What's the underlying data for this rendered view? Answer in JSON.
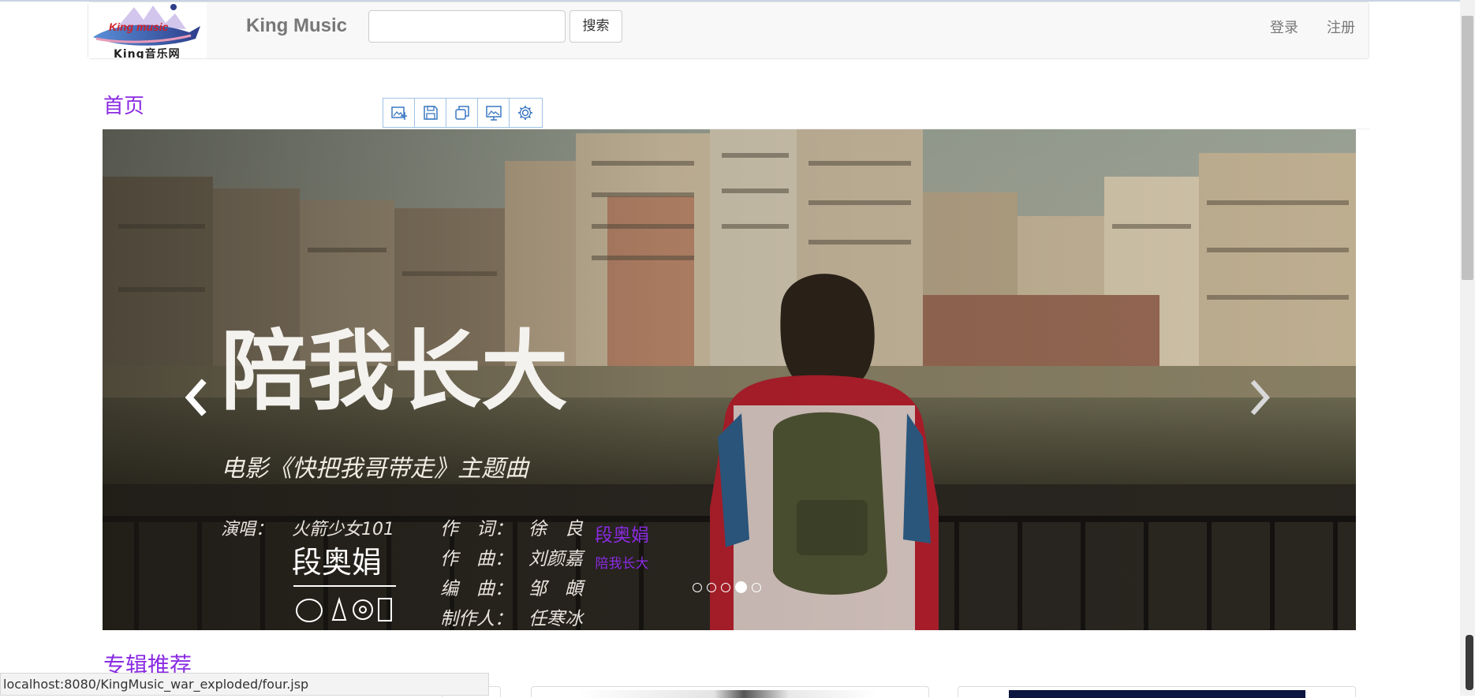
{
  "navbar": {
    "logo_text_top": "King music",
    "logo_text_bottom": "King音乐网",
    "brand": "King Music",
    "search_placeholder": "",
    "search_button": "搜索",
    "login": "登录",
    "register": "注册"
  },
  "page": {
    "title": "首页",
    "section_album": "专辑推荐"
  },
  "image_toolbar": {
    "icons": [
      "image-search-icon",
      "save-icon",
      "copy-icon",
      "screen-image-icon",
      "gear-icon"
    ]
  },
  "carousel": {
    "poster": {
      "title": "陪我长大",
      "subtitle": "电影《快把我哥带走》主题曲",
      "credits_left_label": "演唱：",
      "credits_left_value": "火箭少女101",
      "credits_singer": "段奥娟",
      "credit_lyrics_label": "作　词：",
      "credit_lyrics_value": "徐　良",
      "credit_music_label": "作　曲：",
      "credit_music_value": "刘颜嘉",
      "credit_arrange_label": "编　曲：",
      "credit_arrange_value": "邹　頔",
      "credit_producer_label": "制作人：",
      "credit_producer_value": "任寒冰"
    },
    "caption_title": "段奥娟",
    "caption_subtitle": "陪我长大",
    "slide_count": 5,
    "active_index": 3
  },
  "status_bar": {
    "url": "localhost:8080/KingMusic_war_exploded/four.jsp"
  },
  "colors": {
    "accent": "#8a2be2",
    "navbar_bg": "#f8f8f8",
    "link_gray": "#777777"
  }
}
